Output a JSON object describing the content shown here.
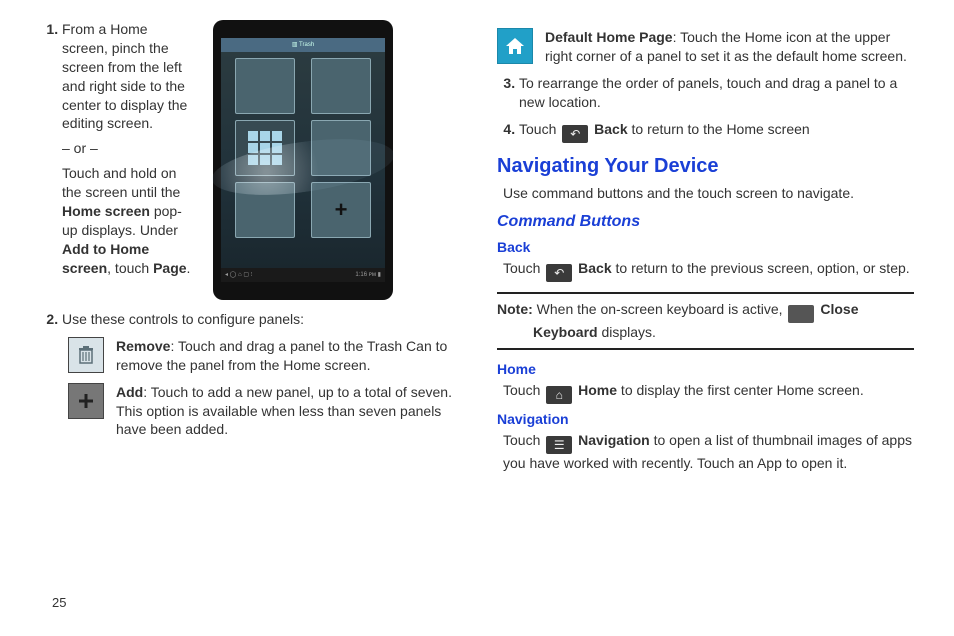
{
  "page_number": "25",
  "left": {
    "step1_part1": "From a Home screen, pinch the screen from the left and right side to the center to display the editing screen.",
    "or": "– or –",
    "step1_part2a": "Touch and hold on the screen until the ",
    "step1_bold_a": "Home screen",
    "step1_part2b": " pop-up displays. Under ",
    "step1_bold_b": "Add to Home screen",
    "step1_part2c": ", touch ",
    "step1_bold_c": "Page",
    "step1_part2d": ".",
    "step2": "Use these controls to configure panels:",
    "remove_bold": "Remove",
    "remove_text": ": Touch and drag a panel to the Trash Can to remove the panel from the Home screen.",
    "add_bold": "Add",
    "add_text": ": Touch to add a new panel, up to a total of seven. This option is available when less than seven panels have been added."
  },
  "tablet": {
    "header": "▥ Trash",
    "footer_left": "◂ ◯ ⌂ ▢ ⁝",
    "footer_right": "1:16 ᴘᴍ ▮"
  },
  "right": {
    "default_bold": "Default Home Page",
    "default_text": ": Touch the Home icon at the upper right corner of a panel to set it as the default home screen.",
    "step3": "To rearrange the order of panels, touch and drag a panel to a new location.",
    "step4a": "Touch ",
    "step4_bold": "Back",
    "step4b": " to return to the Home screen",
    "h2": "Navigating Your Device",
    "h2_sub": "Use command buttons and the touch screen to navigate.",
    "h3": "Command Buttons",
    "back_h": "Back",
    "back_a": "Touch ",
    "back_bold": "Back",
    "back_b": " to return to the previous screen, option, or step.",
    "note_label": "Note:",
    "note_a": " When the on-screen keyboard is active, ",
    "note_bold": "Close Keyboard",
    "note_b": " displays.",
    "home_h": "Home",
    "home_a": "Touch ",
    "home_bold": "Home",
    "home_b": " to display the first center Home screen.",
    "nav_h": "Navigation",
    "nav_a": "Touch ",
    "nav_bold": "Navigation",
    "nav_b": " to open a list of thumbnail images of apps you have worked with recently. Touch an App to open it."
  }
}
